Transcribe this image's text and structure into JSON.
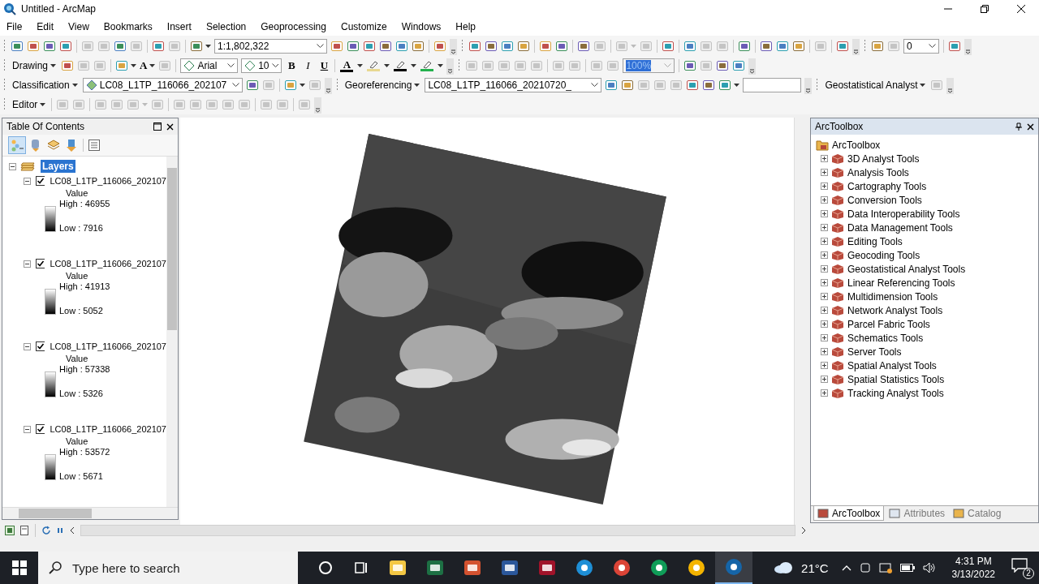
{
  "window": {
    "title": "Untitled - ArcMap"
  },
  "menu": [
    "File",
    "Edit",
    "View",
    "Bookmarks",
    "Insert",
    "Selection",
    "Geoprocessing",
    "Customize",
    "Windows",
    "Help"
  ],
  "toolbars": [
    [
      {
        "items": [
          {
            "kind": "icon",
            "disabled": false
          },
          {
            "kind": "icon",
            "disabled": false
          },
          {
            "kind": "icon",
            "disabled": false
          },
          {
            "kind": "icon",
            "disabled": false
          },
          {
            "kind": "sep"
          },
          {
            "kind": "icon",
            "disabled": true
          },
          {
            "kind": "icon",
            "disabled": true
          },
          {
            "kind": "icon",
            "disabled": false
          },
          {
            "kind": "icon",
            "disabled": true
          },
          {
            "kind": "sep"
          },
          {
            "kind": "icon",
            "disabled": false
          },
          {
            "kind": "icon",
            "disabled": true
          },
          {
            "kind": "sep"
          },
          {
            "kind": "icon_menu",
            "disabled": false
          },
          {
            "kind": "combo",
            "value": "1:1,802,322"
          },
          {
            "kind": "icon",
            "disabled": false
          },
          {
            "kind": "icon",
            "disabled": false
          },
          {
            "kind": "icon",
            "disabled": false
          },
          {
            "kind": "icon",
            "disabled": false
          },
          {
            "kind": "icon",
            "disabled": false
          },
          {
            "kind": "icon",
            "disabled": false
          },
          {
            "kind": "sep"
          },
          {
            "kind": "icon",
            "disabled": false
          }
        ]
      },
      {
        "items": [
          {
            "kind": "icon",
            "disabled": false
          },
          {
            "kind": "icon",
            "disabled": false
          },
          {
            "kind": "icon",
            "disabled": false
          },
          {
            "kind": "icon",
            "disabled": false
          },
          {
            "kind": "sep"
          },
          {
            "kind": "icon",
            "disabled": false
          },
          {
            "kind": "icon",
            "disabled": false
          },
          {
            "kind": "sep"
          },
          {
            "kind": "icon",
            "disabled": false
          },
          {
            "kind": "icon",
            "disabled": true
          },
          {
            "kind": "sep"
          },
          {
            "kind": "icon_menu",
            "disabled": true
          },
          {
            "kind": "icon",
            "disabled": true
          },
          {
            "kind": "sep"
          },
          {
            "kind": "icon",
            "disabled": false
          },
          {
            "kind": "sep"
          },
          {
            "kind": "icon",
            "disabled": false
          },
          {
            "kind": "icon",
            "disabled": true
          },
          {
            "kind": "icon",
            "disabled": true
          },
          {
            "kind": "sep"
          },
          {
            "kind": "icon",
            "disabled": false
          },
          {
            "kind": "sep"
          },
          {
            "kind": "icon",
            "disabled": false
          },
          {
            "kind": "icon",
            "disabled": false
          },
          {
            "kind": "icon",
            "disabled": false
          },
          {
            "kind": "sep"
          },
          {
            "kind": "icon",
            "disabled": true
          },
          {
            "kind": "sep"
          },
          {
            "kind": "icon",
            "disabled": false
          }
        ]
      },
      {
        "items": [
          {
            "kind": "icon",
            "disabled": false
          },
          {
            "kind": "icon",
            "disabled": true
          },
          {
            "kind": "combo",
            "value": "0"
          },
          {
            "kind": "sep"
          },
          {
            "kind": "icon",
            "disabled": false
          }
        ]
      }
    ],
    [
      {
        "items": [
          {
            "kind": "dropdown",
            "label": "Drawing"
          },
          {
            "kind": "icon",
            "disabled": false
          },
          {
            "kind": "icon",
            "disabled": true
          },
          {
            "kind": "icon",
            "disabled": true
          },
          {
            "kind": "sep"
          },
          {
            "kind": "icon_menu",
            "disabled": false
          },
          {
            "kind": "text_tool",
            "text": "A"
          },
          {
            "kind": "icon",
            "disabled": true
          },
          {
            "kind": "sep"
          },
          {
            "kind": "combo",
            "value": "Arial"
          },
          {
            "kind": "combo",
            "value": "10"
          },
          {
            "kind": "bold",
            "text": "B"
          },
          {
            "kind": "italic",
            "text": "I"
          },
          {
            "kind": "underline",
            "text": "U"
          },
          {
            "kind": "sep"
          },
          {
            "kind": "color",
            "text": "A",
            "color": "#000000"
          },
          {
            "kind": "color",
            "color": "#e8d890"
          },
          {
            "kind": "color",
            "color": "#000000"
          },
          {
            "kind": "color",
            "color": "#22b14c"
          }
        ]
      },
      {
        "items": [
          {
            "kind": "icon",
            "disabled": true
          },
          {
            "kind": "icon",
            "disabled": true
          },
          {
            "kind": "icon",
            "disabled": true
          },
          {
            "kind": "icon",
            "disabled": true
          },
          {
            "kind": "icon",
            "disabled": true
          },
          {
            "kind": "sep"
          },
          {
            "kind": "icon",
            "disabled": true
          },
          {
            "kind": "icon",
            "disabled": true
          },
          {
            "kind": "sep"
          },
          {
            "kind": "icon",
            "disabled": true
          },
          {
            "kind": "icon",
            "disabled": true
          },
          {
            "kind": "combo",
            "value": "100%",
            "disabled": true
          },
          {
            "kind": "sep"
          },
          {
            "kind": "icon",
            "disabled": false
          },
          {
            "kind": "icon",
            "disabled": true
          },
          {
            "kind": "icon",
            "disabled": false
          },
          {
            "kind": "icon",
            "disabled": false
          }
        ]
      }
    ],
    [
      {
        "items": [
          {
            "kind": "dropdown",
            "label": "Classification"
          },
          {
            "kind": "combo",
            "value": "LC08_L1TP_116066_202107"
          },
          {
            "kind": "icon",
            "disabled": false
          },
          {
            "kind": "icon",
            "disabled": true
          },
          {
            "kind": "sep"
          },
          {
            "kind": "icon_menu",
            "disabled": false
          },
          {
            "kind": "icon",
            "disabled": true
          }
        ]
      },
      {
        "items": [
          {
            "kind": "dropdown",
            "label": "Georeferencing"
          },
          {
            "kind": "combo",
            "value": "LC08_L1TP_116066_20210720_"
          },
          {
            "kind": "icon",
            "disabled": false
          },
          {
            "kind": "icon",
            "disabled": false
          },
          {
            "kind": "icon",
            "disabled": true
          },
          {
            "kind": "icon",
            "disabled": true
          },
          {
            "kind": "icon",
            "disabled": true
          },
          {
            "kind": "icon",
            "disabled": false
          },
          {
            "kind": "icon",
            "disabled": false
          },
          {
            "kind": "icon_menu",
            "disabled": false
          },
          {
            "kind": "field"
          }
        ]
      },
      {
        "items": [
          {
            "kind": "dropdown",
            "label": "Geostatistical Analyst"
          },
          {
            "kind": "icon",
            "disabled": true
          }
        ]
      }
    ],
    [
      {
        "items": [
          {
            "kind": "dropdown",
            "label": "Editor"
          },
          {
            "kind": "sep"
          },
          {
            "kind": "icon",
            "disabled": true
          },
          {
            "kind": "icon",
            "disabled": true
          },
          {
            "kind": "sep"
          },
          {
            "kind": "icon",
            "disabled": true
          },
          {
            "kind": "icon",
            "disabled": true
          },
          {
            "kind": "icon_menu",
            "disabled": true
          },
          {
            "kind": "icon",
            "disabled": true
          },
          {
            "kind": "sep"
          },
          {
            "kind": "icon",
            "disabled": true
          },
          {
            "kind": "icon",
            "disabled": true
          },
          {
            "kind": "icon",
            "disabled": true
          },
          {
            "kind": "icon",
            "disabled": true
          },
          {
            "kind": "icon",
            "disabled": true
          },
          {
            "kind": "sep"
          },
          {
            "kind": "icon",
            "disabled": true
          },
          {
            "kind": "icon",
            "disabled": true
          },
          {
            "kind": "sep"
          },
          {
            "kind": "icon",
            "disabled": true
          }
        ]
      }
    ]
  ],
  "toc": {
    "title": "Table Of Contents",
    "root": {
      "label": "Layers",
      "selected": true,
      "expanded": true
    },
    "layers": [
      {
        "name": "LC08_L1TP_116066_202107",
        "checked": true,
        "expanded": true,
        "legend": {
          "title": "Value",
          "high": "High : 46955",
          "low": "Low : 7916"
        }
      },
      {
        "name": "LC08_L1TP_116066_202107",
        "checked": true,
        "expanded": true,
        "legend": {
          "title": "Value",
          "high": "High : 41913",
          "low": "Low : 5052"
        }
      },
      {
        "name": "LC08_L1TP_116066_202107",
        "checked": true,
        "expanded": true,
        "legend": {
          "title": "Value",
          "high": "High : 57338",
          "low": "Low : 5326"
        }
      },
      {
        "name": "LC08_L1TP_116066_202107",
        "checked": true,
        "expanded": true,
        "legend": {
          "title": "Value",
          "high": "High : 53572",
          "low": "Low : 5671"
        }
      }
    ]
  },
  "toolbox": {
    "title": "ArcToolbox",
    "root": "ArcToolbox",
    "items": [
      {
        "label": "3D Analyst Tools",
        "expanded": false
      },
      {
        "label": "Analysis Tools",
        "expanded": false
      },
      {
        "label": "Cartography Tools",
        "expanded": false
      },
      {
        "label": "Conversion Tools",
        "expanded": false
      },
      {
        "label": "Data Interoperability Tools",
        "expanded": false
      },
      {
        "label": "Data Management Tools",
        "expanded": false
      },
      {
        "label": "Editing Tools",
        "expanded": false
      },
      {
        "label": "Geocoding Tools",
        "expanded": false
      },
      {
        "label": "Geostatistical Analyst Tools",
        "expanded": false
      },
      {
        "label": "Linear Referencing Tools",
        "expanded": false
      },
      {
        "label": "Multidimension Tools",
        "expanded": false
      },
      {
        "label": "Network Analyst Tools",
        "expanded": false
      },
      {
        "label": "Parcel Fabric Tools",
        "expanded": false
      },
      {
        "label": "Schematics Tools",
        "expanded": false
      },
      {
        "label": "Server Tools",
        "expanded": false
      },
      {
        "label": "Spatial Analyst Tools",
        "expanded": false
      },
      {
        "label": "Spatial Statistics Tools",
        "expanded": false
      },
      {
        "label": "Tracking Analyst Tools",
        "expanded": false
      }
    ],
    "tabs": [
      {
        "label": "ArcToolbox",
        "selected": true
      },
      {
        "label": "Attributes",
        "selected": false
      },
      {
        "label": "Catalog",
        "selected": false
      }
    ]
  },
  "taskbar": {
    "search": {
      "placeholder": "Type here to search"
    },
    "apps": [
      {
        "active": false
      },
      {
        "active": false
      },
      {
        "active": false
      },
      {
        "active": false
      },
      {
        "active": false
      },
      {
        "active": false
      },
      {
        "active": false
      },
      {
        "active": false
      },
      {
        "active": false
      },
      {
        "active": true
      }
    ],
    "weather": "21°C",
    "time": "4:31 PM",
    "date": "3/13/2022",
    "notifications": "2"
  }
}
